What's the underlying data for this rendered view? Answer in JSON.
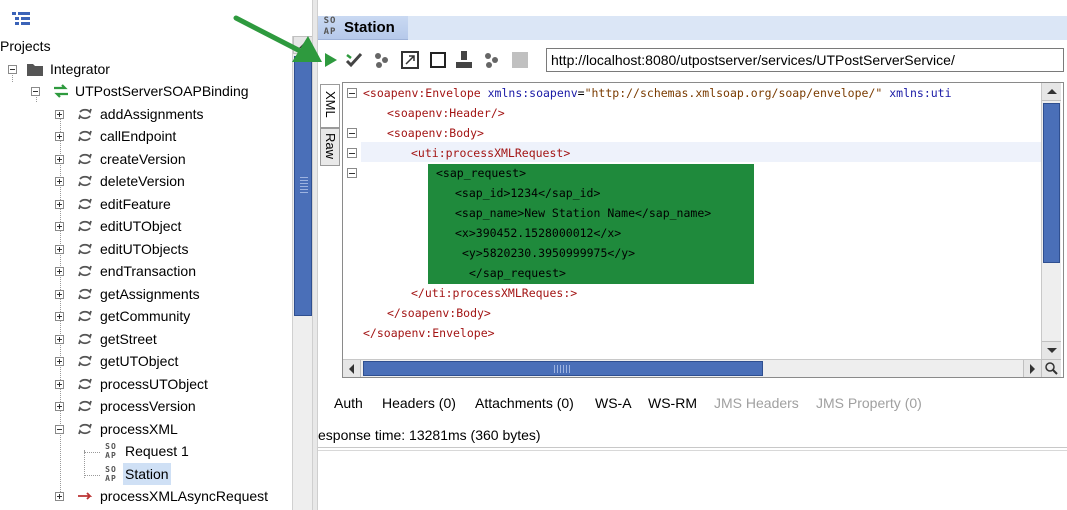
{
  "left_panel": {
    "projects_label": "Projects",
    "tree": [
      {
        "label": "Integrator"
      },
      {
        "label": "UTPostServerSOAPBinding"
      },
      {
        "label": "addAssignments"
      },
      {
        "label": "callEndpoint"
      },
      {
        "label": "createVersion"
      },
      {
        "label": "deleteVersion"
      },
      {
        "label": "editFeature"
      },
      {
        "label": "editUTObject"
      },
      {
        "label": "editUTObjects"
      },
      {
        "label": "endTransaction"
      },
      {
        "label": "getAssignments"
      },
      {
        "label": "getCommunity"
      },
      {
        "label": "getStreet"
      },
      {
        "label": "getUTObject"
      },
      {
        "label": "processUTObject"
      },
      {
        "label": "processVersion"
      },
      {
        "label": "processXML"
      },
      {
        "label": "Request 1"
      },
      {
        "label": "Station"
      },
      {
        "label": "processXMLAsyncRequest"
      }
    ],
    "soap_icon_text": "SO\nAP"
  },
  "request_panel": {
    "title": "Station",
    "title_icon_text": "SO\nAP",
    "url": "http://localhost:8080/utpostserver/services/UTPostServerService/",
    "side_tabs": {
      "xml": "XML",
      "raw": "Raw"
    },
    "code_lines": [
      {
        "tag_open": "<soapenv:Envelope ",
        "attr": "xmlns:soapenv",
        "eq": "=",
        "val": "\"http://schemas.xmlsoap.org/soap/envelope/\"",
        "rest": " xmlns:uti"
      },
      {
        "text": "<soapenv:Header/>"
      },
      {
        "text": "<soapenv:Body>"
      },
      {
        "text": "<uti:processXMLRequest>"
      },
      {
        "text": "<sap_request>"
      },
      {
        "text": "<sap_id>1234</sap_id>"
      },
      {
        "text": "<sap_name>New Station Name</sap_name>"
      },
      {
        "text": "<x>390452.1528000012</x>"
      },
      {
        "text": "<y>5820230.3950999975</y>"
      },
      {
        "text": "</sap_request>"
      },
      {
        "text": "</uti:processXMLReques:>"
      },
      {
        "text": "</soapenv:Body>"
      },
      {
        "text": "</soapenv:Envelope>"
      }
    ],
    "bottom_tabs": [
      {
        "label": "Auth",
        "enabled": true
      },
      {
        "label": "Headers (0)",
        "enabled": true
      },
      {
        "label": "Attachments (0)",
        "enabled": true
      },
      {
        "label": "WS-A",
        "enabled": true
      },
      {
        "label": "WS-RM",
        "enabled": true
      },
      {
        "label": "JMS Headers",
        "enabled": false
      },
      {
        "label": "JMS Property (0)",
        "enabled": false
      }
    ],
    "status_text": "esponse time: 13281ms (360 bytes)"
  },
  "colors": {
    "highlight_block": "#1f8a3c",
    "arrow": "#2e9a3e",
    "run_button": "#2e9a3e",
    "scroll_thumb": "#4a6fb8",
    "title_bar": "#c9d9f2"
  }
}
